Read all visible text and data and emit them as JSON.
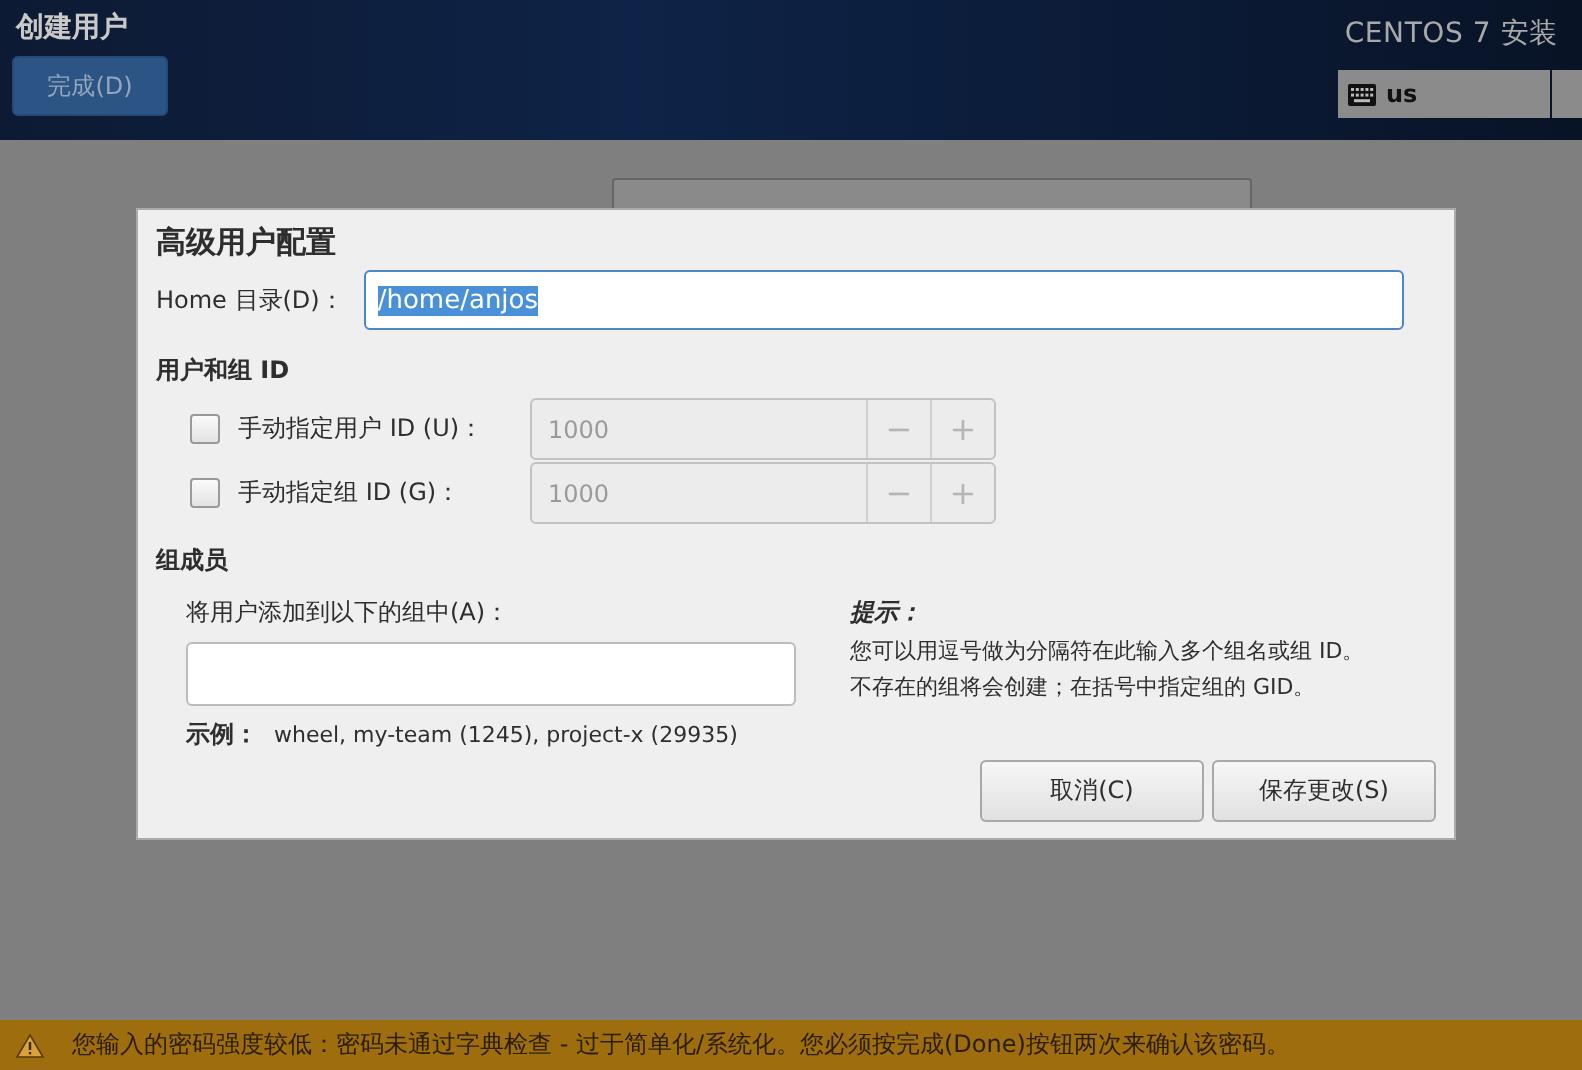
{
  "header": {
    "title": "创建用户",
    "done_button": "完成(D)",
    "product": "CENTOS 7 安装",
    "keyboard_layout": "us"
  },
  "dialog": {
    "title": "高级用户配置",
    "home": {
      "label": "Home 目录(D)：",
      "value": "/home/anjos",
      "selected_text": true
    },
    "ids_heading": "用户和组 ID",
    "id_rows": [
      {
        "label": "手动指定用户 ID (U)：",
        "checked": false,
        "value": "1000",
        "minus": "−",
        "plus": "+"
      },
      {
        "label": "手动指定组 ID (G)：",
        "checked": false,
        "value": "1000",
        "minus": "−",
        "plus": "+"
      }
    ],
    "groups_heading": "组成员",
    "groups_label": "将用户添加到以下的组中(A)：",
    "example_label": "示例：",
    "example_text": "wheel, my-team (1245), project-x (29935)",
    "hint_title": "提示：",
    "hint_lines": [
      "您可以用逗号做为分隔符在此输入多个组名或组 ID。",
      "不存在的组将会创建；在括号中指定组的 GID。"
    ],
    "buttons": [
      {
        "label": "取消(C)"
      },
      {
        "label": "保存更改(S)"
      }
    ]
  },
  "warning": "您输入的密码强度较低：密码未通过字典检查 - 过于简单化/系统化。您必须按完成(Done)按钮两次来确认该密码。"
}
